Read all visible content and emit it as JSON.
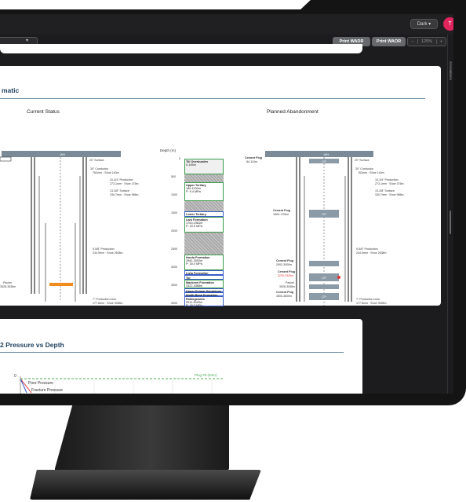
{
  "header": {
    "theme_label": "Dark ▾",
    "avatar_initial": "T"
  },
  "toolbar": {
    "print_wadr": "Print WADR",
    "print_waor": "Print WAOR",
    "zoom_minus": "−",
    "zoom_value": "125%",
    "zoom_plus": "+",
    "select_arrow": "▾"
  },
  "sidebar": {
    "label": "Annotations"
  },
  "schematic": {
    "title": "matic",
    "current_status": "Current Status",
    "planned_abandonment": "Planned Abandonment",
    "depth_label": "Depth (m)",
    "depth_ticks": [
      "0",
      "500",
      "1000",
      "1500",
      "2000",
      "2500",
      "3000",
      "3500",
      "4000"
    ],
    "wh": "WH",
    "cp": "CP",
    "annotations_left": {
      "conductor": "30\" Conductor",
      "conductor_sub": "762mm · Shoe 140m",
      "surface": "20\" Surface",
      "production_1034": "10-3/4\" Production",
      "production_1034_sub": "273.1mm · Shoe 375m",
      "surface_1338": "13-3/8\" Surface",
      "surface_1338_sub": "339.7mm · Shoe 986m",
      "production_958": "9-5/8\" Production",
      "production_958_sub": "244.5mm · Shoe 2638m",
      "packer": "Packer",
      "packer_sub": "3528-3538m",
      "liner": "7\" Production Liner",
      "liner_sub": "177.8mm · Shoe 3926m"
    },
    "strata": [
      {
        "name": "Till Overburden",
        "sub": "0-185m"
      },
      {
        "name": "Upper Tertiary",
        "sub": "185-1100m",
        "extra": "P: 9.4 MPa"
      },
      {
        "name": "Lower Tertiary",
        "sub": ""
      },
      {
        "name": "Lark Formation",
        "sub": "1700-1981m",
        "extra": "P: 20.0 MPa"
      },
      {
        "name": "Horda Formation",
        "sub": "2981-3002m",
        "extra": "P: 30.0 MPa"
      },
      {
        "name": "Lista Formation",
        "sub": ""
      },
      {
        "name": "Tor",
        "sub": ""
      },
      {
        "name": "Mackerel Formation",
        "sub": "3322-3368m"
      },
      {
        "name": "Upper Fulmar Sandstone",
        "sub": ""
      },
      {
        "name": "Smith Bank Formation",
        "sub": ""
      },
      {
        "name": "Rotliegendes",
        "sub": "3911-3943m",
        "extra": "P: 40.0 MPa"
      }
    ],
    "plugs": {
      "cement_plug_top": "Cement Plug",
      "cement_plug_top_sub": "84-114m",
      "cement_plug_mid": "Cement Plug",
      "cement_plug_mid_sub": "1600-1700m",
      "cement_plug_a": "Cement Plug",
      "cement_plug_a_sub": "2902-3000m",
      "cement_plug_b": "Cement Plug",
      "cement_plug_b_sub": "3220-3320m",
      "packer": "Packer",
      "packer_sub": "3528-3538m",
      "cement_plug_c": "Cement Plug",
      "cement_plug_c_sub": "3500-3600m"
    }
  },
  "pressure": {
    "title": "2 Pressure vs Depth",
    "y_zero": "0",
    "legend": [
      "Pore Pressure",
      "Fracture Pressure"
    ],
    "plug_label": "Plug #5 (84m)"
  },
  "colors": {
    "accent": "#1a3e5c",
    "wellhead": "#7a8a96",
    "packer_orange": "#f08c1e",
    "plug_gray": "#8a9aa6",
    "avatar": "#e0245e",
    "strata_green": "#3a9c4a",
    "strata_blue": "#3a5cc8"
  }
}
